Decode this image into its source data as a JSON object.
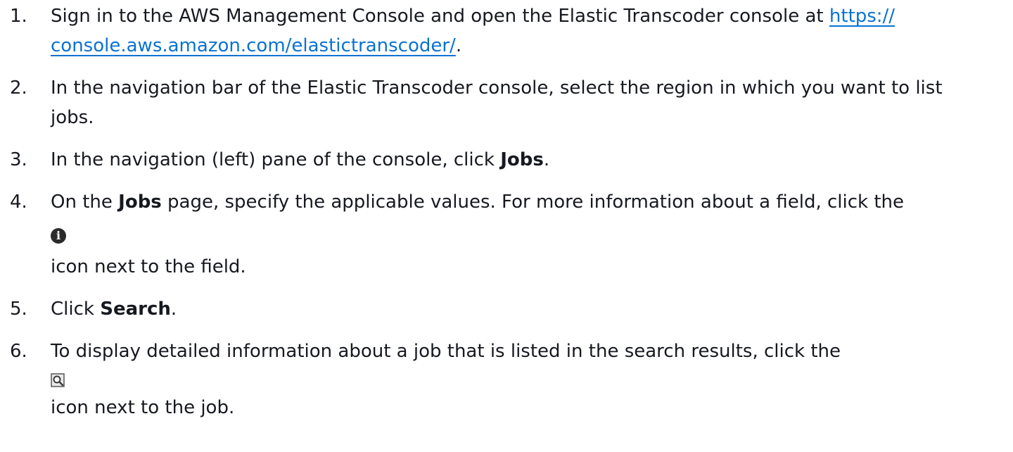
{
  "steps": [
    {
      "number": "1.",
      "text_before": "Sign in to the AWS Management Console and open the Elastic Transcoder console at ",
      "link_line1": "https://",
      "link_line2": "console.aws.amazon.com/elastictranscoder/",
      "text_after": "."
    },
    {
      "number": "2.",
      "text": "In the navigation bar of the Elastic Transcoder console, select the region in which you want to list jobs."
    },
    {
      "number": "3.",
      "text_before": "In the navigation (left) pane of the console, click ",
      "bold": "Jobs",
      "text_after": "."
    },
    {
      "number": "4.",
      "text_before": "On the ",
      "bold": "Jobs",
      "text_middle": " page, specify the applicable values. For more information about a field, click the",
      "icon": "info-icon",
      "text_after": "icon next to the field."
    },
    {
      "number": "5.",
      "text_before": "Click ",
      "bold": "Search",
      "text_after": "."
    },
    {
      "number": "6.",
      "text_before": "To display detailed information about a job that is listed in the search results, click the",
      "icon": "magnifier-icon",
      "text_after": "icon next to the job."
    }
  ],
  "colors": {
    "text": "#16191f",
    "link": "#0972d3",
    "icon": "#2b2b2b"
  }
}
